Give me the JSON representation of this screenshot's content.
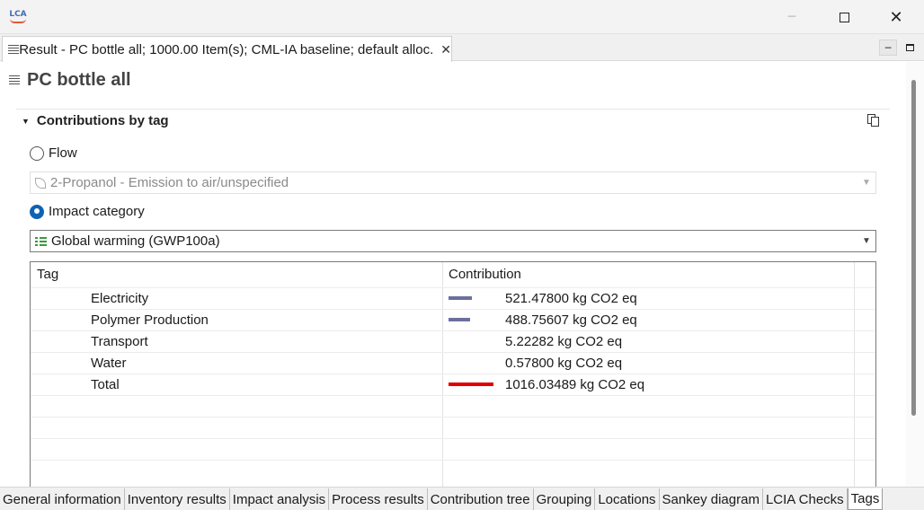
{
  "window": {
    "logo_text": "LCA",
    "minimize_glyph": "─",
    "close_glyph": "✕"
  },
  "editor_tab": {
    "label": "Result - PC bottle all; 1000.00 Item(s); CML-IA baseline; default alloc.",
    "close_glyph": "✕"
  },
  "page": {
    "title": "PC bottle all"
  },
  "section": {
    "title": "Contributions by tag",
    "twisty": "▼"
  },
  "selection": {
    "flow_label": "Flow",
    "flow_value": "2-Propanol - Emission to air/unspecified",
    "impact_label": "Impact category",
    "impact_value": "Global warming (GWP100a)",
    "selected": "impact",
    "dropdown_glyph": "▼"
  },
  "table": {
    "headers": {
      "tag": "Tag",
      "contribution": "Contribution"
    },
    "rows": [
      {
        "tag": "Electricity",
        "value": "521.47800 kg CO2 eq",
        "share": 0.513,
        "color": "#6b6f9c"
      },
      {
        "tag": "Polymer Production",
        "value": "488.75607 kg CO2 eq",
        "share": 0.481,
        "color": "#6b6f9c"
      },
      {
        "tag": "Transport",
        "value": "5.22282 kg CO2 eq",
        "share": 0.005,
        "color": "#6b6f9c"
      },
      {
        "tag": "Water",
        "value": "0.57800 kg CO2 eq",
        "share": 0.0006,
        "color": "#6b6f9c"
      },
      {
        "tag": "Total",
        "value": "1016.03489 kg CO2 eq",
        "share": 1.0,
        "color": "#e00000"
      }
    ]
  },
  "bottom_tabs": [
    {
      "label": "General information",
      "active": false
    },
    {
      "label": "Inventory results",
      "active": false
    },
    {
      "label": "Impact analysis",
      "active": false
    },
    {
      "label": "Process results",
      "active": false
    },
    {
      "label": "Contribution tree",
      "active": false
    },
    {
      "label": "Grouping",
      "active": false
    },
    {
      "label": "Locations",
      "active": false
    },
    {
      "label": "Sankey diagram",
      "active": false
    },
    {
      "label": "LCIA Checks",
      "active": false
    },
    {
      "label": "Tags",
      "active": true
    }
  ]
}
